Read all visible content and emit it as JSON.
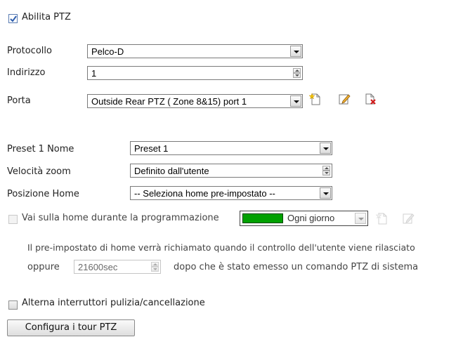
{
  "enable_ptz": {
    "label": "Abilita PTZ",
    "checked": true
  },
  "protocol": {
    "label": "Protocollo",
    "value": "Pelco-D"
  },
  "address": {
    "label": "Indirizzo",
    "value": "1"
  },
  "port": {
    "label": "Porta",
    "value": "Outside Rear PTZ ( Zone 8&15) port 1"
  },
  "preset_name": {
    "label": "Preset 1 Nome",
    "value": "Preset 1"
  },
  "zoom_speed": {
    "label": "Velocità zoom",
    "value": "Definito dall'utente"
  },
  "home_position": {
    "label": "Posizione Home",
    "value": "-- Seleziona home pre-impostato --"
  },
  "goto_home": {
    "label": "Vai sulla home durante la programmazione",
    "schedule_color": "#00a000",
    "schedule_value": "Ogni giorno",
    "checked": false
  },
  "home_info": {
    "line1": "Il pre-impostato di home verrà richiamato quando il controllo dell'utente viene rilasciato",
    "or_label": "oppure",
    "timeout_value": "21600sec",
    "after_text": "dopo che è stato emesso un comando PTZ di sistema"
  },
  "wiper_toggle": {
    "label": "Alterna interruttori pulizia/cancellazione",
    "checked": false
  },
  "configure_tours_button": "Configura i tour PTZ",
  "colors": {
    "checkbox_accent": "#2f5fae",
    "delete_icon_red": "#d11a1a",
    "new_icon_star": "#f2c200"
  }
}
